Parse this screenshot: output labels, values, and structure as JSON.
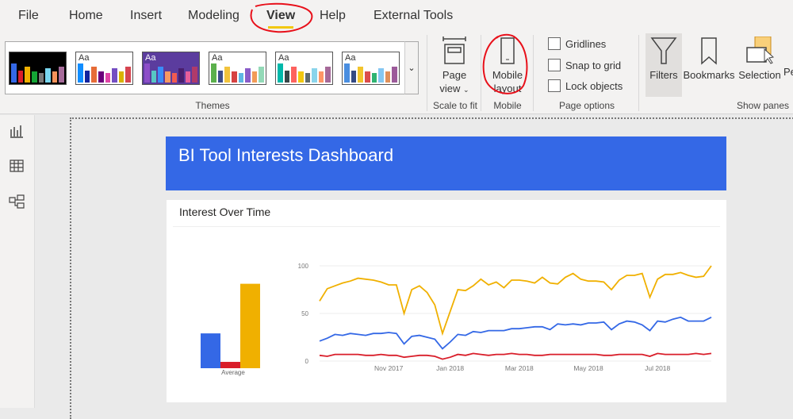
{
  "menu": {
    "items": [
      "File",
      "Home",
      "Insert",
      "Modeling",
      "View",
      "Help",
      "External Tools"
    ],
    "active": "View"
  },
  "ribbon": {
    "themes_label": "Themes",
    "themes": [
      {
        "bg": "#000000",
        "aa": false,
        "colors": [
          "#3468e6",
          "#d91e2a",
          "#f0b000",
          "#14a535",
          "#7a7a7a",
          "#7ad7f0",
          "#f7935a",
          "#a66b9a"
        ]
      },
      {
        "bg": "#ffffff",
        "aa": true,
        "colors": [
          "#118dff",
          "#12239e",
          "#e66c37",
          "#6b007b",
          "#e044a7",
          "#744ec2",
          "#d9b300",
          "#d64550"
        ]
      },
      {
        "bg": "#5b3c9e",
        "aa": true,
        "colors": [
          "#8c4ec8",
          "#56c7c4",
          "#3a8cf7",
          "#f79862",
          "#f25b50",
          "#4a1f6e",
          "#e85d9a",
          "#b03a6a"
        ]
      },
      {
        "bg": "#ffffff",
        "aa": true,
        "colors": [
          "#5bb04c",
          "#3d4c8a",
          "#f2c33c",
          "#d64242",
          "#5eb6e4",
          "#8a5cc9",
          "#f29b57",
          "#93d9b7"
        ]
      },
      {
        "bg": "#ffffff",
        "aa": true,
        "colors": [
          "#01b8aa",
          "#374649",
          "#fd625e",
          "#f2c80f",
          "#5f6b6d",
          "#8ad4eb",
          "#fe9666",
          "#a66999"
        ]
      },
      {
        "bg": "#ffffff",
        "aa": true,
        "colors": [
          "#4a8ee0",
          "#344983",
          "#f2c42c",
          "#db4c4c",
          "#2fb371",
          "#85c7f2",
          "#e0905a",
          "#9c5a9a"
        ]
      }
    ],
    "theme_aa": "Aa",
    "page_view": [
      "Page",
      "view"
    ],
    "scale_label": "Scale to fit",
    "mobile_layout": [
      "Mobile",
      "layout"
    ],
    "mobile_label": "Mobile",
    "page_options": [
      "Gridlines",
      "Snap to grid",
      "Lock objects"
    ],
    "page_options_label": "Page options",
    "panes": [
      "Filters",
      "Bookmarks",
      "Selection",
      "Pe"
    ],
    "panes_label": "Show panes"
  },
  "dashboard": {
    "title": "BI Tool Interests Dashboard",
    "card_title": "Interest Over Time"
  },
  "colors": {
    "blue": "#3468e6",
    "red": "#d91e2a",
    "yellow": "#f0b000",
    "annotation": "#e8101a"
  },
  "chart_data": [
    {
      "type": "bar",
      "categories": [
        "Average"
      ],
      "series": [
        {
          "name": "blue",
          "values": [
            33
          ]
        },
        {
          "name": "red",
          "values": [
            6
          ]
        },
        {
          "name": "yellow",
          "values": [
            80
          ]
        }
      ],
      "ylim": [
        0,
        100
      ]
    },
    {
      "type": "line",
      "ylim": [
        0,
        100
      ],
      "yticks": [
        "0",
        "50",
        "100"
      ],
      "xticks": [
        "Nov 2017",
        "Jan 2018",
        "Mar 2018",
        "May 2018",
        "Jul 2018"
      ],
      "xtick_index": [
        9,
        17,
        26,
        35,
        44
      ],
      "series": [
        {
          "name": "yellow",
          "values": [
            63,
            76,
            79,
            82,
            84,
            87,
            86,
            85,
            83,
            80,
            80,
            50,
            75,
            79,
            72,
            59,
            29,
            52,
            75,
            74,
            79,
            86,
            80,
            83,
            77,
            85,
            85,
            84,
            82,
            88,
            82,
            81,
            88,
            92,
            86,
            84,
            84,
            83,
            75,
            85,
            90,
            90,
            92,
            67,
            86,
            91,
            91,
            93,
            90,
            88,
            89,
            100
          ]
        },
        {
          "name": "blue",
          "values": [
            21,
            24,
            28,
            27,
            29,
            28,
            27,
            29,
            29,
            30,
            29,
            18,
            26,
            27,
            25,
            23,
            13,
            20,
            28,
            27,
            31,
            30,
            32,
            32,
            32,
            34,
            34,
            35,
            36,
            36,
            33,
            39,
            38,
            39,
            38,
            40,
            40,
            41,
            33,
            39,
            42,
            41,
            38,
            32,
            42,
            41,
            44,
            46,
            42,
            42,
            42,
            46
          ]
        },
        {
          "name": "red",
          "values": [
            6,
            5,
            7,
            7,
            7,
            7,
            6,
            6,
            7,
            6,
            6,
            4,
            5,
            6,
            6,
            5,
            2,
            4,
            7,
            6,
            8,
            7,
            6,
            7,
            7,
            8,
            7,
            7,
            6,
            6,
            7,
            7,
            7,
            7,
            7,
            7,
            7,
            6,
            6,
            7,
            7,
            7,
            7,
            5,
            8,
            7,
            7,
            7,
            7,
            8,
            7,
            8
          ]
        }
      ]
    }
  ]
}
